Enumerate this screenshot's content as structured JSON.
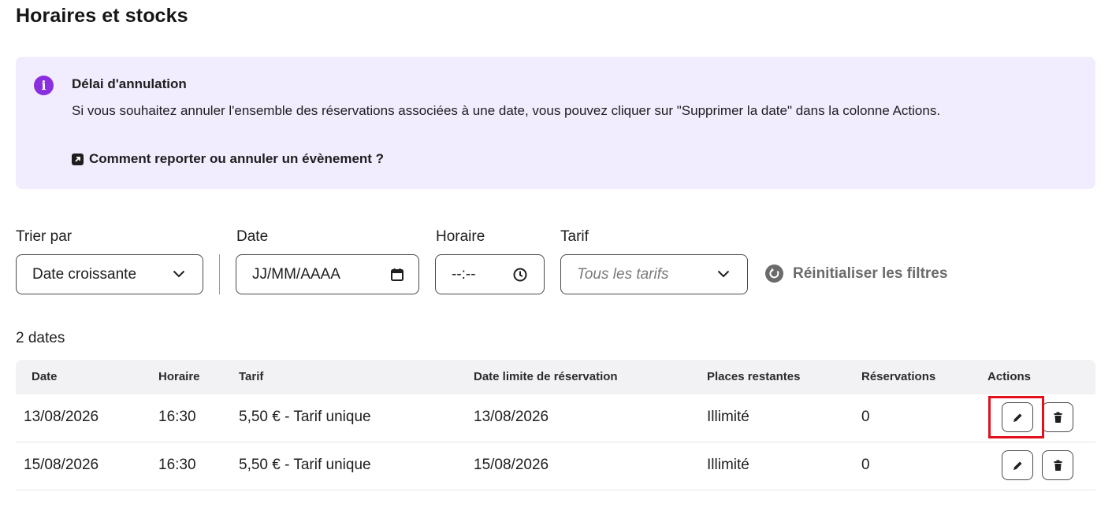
{
  "page": {
    "title": "Horaires et stocks"
  },
  "callout": {
    "title": "Délai d'annulation",
    "body": "Si vous souhaitez annuler l'ensemble des réservations associées à une date, vous pouvez cliquer sur \"Supprimer la date\" dans la colonne Actions.",
    "link": "Comment reporter ou annuler un évènement ?",
    "accent_color": "#8a2fe0",
    "background_color": "#f1ecfe"
  },
  "filters": {
    "sort": {
      "label": "Trier par",
      "value": "Date croissante"
    },
    "date": {
      "label": "Date",
      "placeholder": "JJ/MM/AAAA"
    },
    "time": {
      "label": "Horaire",
      "placeholder": "--:--"
    },
    "tarif": {
      "label": "Tarif",
      "placeholder": "Tous les tarifs"
    },
    "reset_label": "Réinitialiser les filtres"
  },
  "table": {
    "count_label": "2 dates",
    "headers": {
      "date": "Date",
      "horaire": "Horaire",
      "tarif": "Tarif",
      "date_limite": "Date limite de réservation",
      "places": "Places restantes",
      "reservations": "Réservations",
      "actions": "Actions"
    },
    "rows": [
      {
        "date": "13/08/2026",
        "horaire": "16:30",
        "tarif": "5,50 € - Tarif unique",
        "date_limite": "13/08/2026",
        "places": "Illimité",
        "reservations": "0"
      },
      {
        "date": "15/08/2026",
        "horaire": "16:30",
        "tarif": "5,50 € - Tarif unique",
        "date_limite": "15/08/2026",
        "places": "Illimité",
        "reservations": "0"
      }
    ]
  },
  "highlight_color": "#e3101e"
}
